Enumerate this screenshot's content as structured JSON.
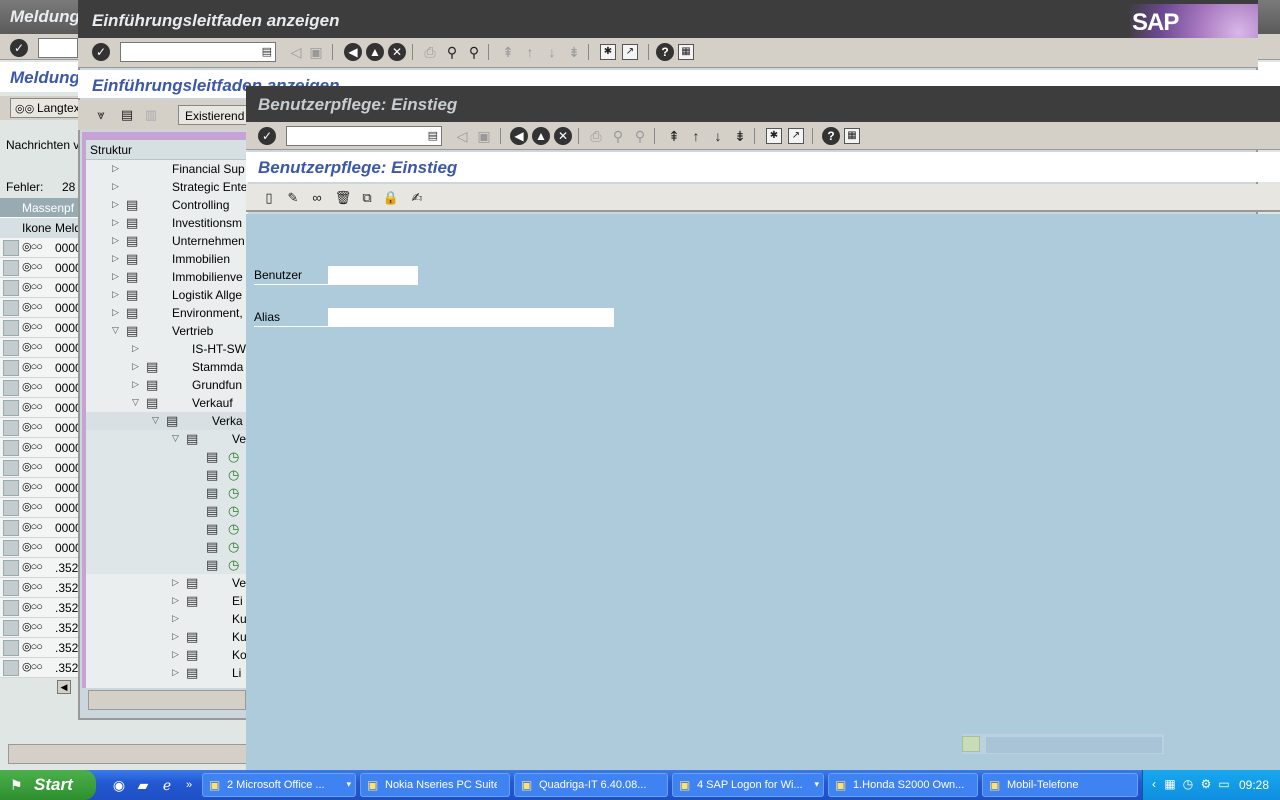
{
  "window_back": {
    "title": "Meldung",
    "app_title": "Meldung",
    "langtext_button": "Langtex",
    "nachrichten_label": "Nachrichten v",
    "fehler_label": "Fehler:",
    "fehler_count": "28",
    "table_header": "Massenpf",
    "columns": [
      "Ikone",
      "Meld"
    ],
    "rows": [
      {
        "lights": "◎○○",
        "msg": "0000"
      },
      {
        "lights": "◎○○",
        "msg": "0000"
      },
      {
        "lights": "◎○○",
        "msg": "0000"
      },
      {
        "lights": "◎○○",
        "msg": "0000"
      },
      {
        "lights": "◎○○",
        "msg": "0000"
      },
      {
        "lights": "◎○○",
        "msg": "0000"
      },
      {
        "lights": "◎○○",
        "msg": "0000"
      },
      {
        "lights": "◎○○",
        "msg": "0000"
      },
      {
        "lights": "◎○○",
        "msg": "0000"
      },
      {
        "lights": "◎○○",
        "msg": "0000"
      },
      {
        "lights": "◎○○",
        "msg": "0000"
      },
      {
        "lights": "◎○○",
        "msg": "0000"
      },
      {
        "lights": "◎○○",
        "msg": "0000"
      },
      {
        "lights": "◎○○",
        "msg": "0000"
      },
      {
        "lights": "◎○○",
        "msg": "0000"
      },
      {
        "lights": "◎○○",
        "msg": "0000"
      },
      {
        "lights": "◎○○",
        "msg": ".352"
      },
      {
        "lights": "◎○○",
        "msg": ".352"
      },
      {
        "lights": "◎○○",
        "msg": ".352"
      },
      {
        "lights": "◎○○",
        "msg": ".352"
      },
      {
        "lights": "◎○○",
        "msg": ".352"
      },
      {
        "lights": "◎○○",
        "msg": ".352"
      }
    ]
  },
  "window_middle": {
    "title": "Einführungsleitfaden anzeigen",
    "app_title": "Einführungsleitfaden anzeigen",
    "sap_logo": "SAP",
    "existierend_button": "Existierend",
    "tree_header": "Struktur",
    "tree": [
      {
        "label": "Financial Sup",
        "indent": 0,
        "expanded": false,
        "doc": false
      },
      {
        "label": "Strategic Ente",
        "indent": 0,
        "expanded": false,
        "doc": false
      },
      {
        "label": "Controlling",
        "indent": 0,
        "expanded": false,
        "doc": true
      },
      {
        "label": "Investitionsm",
        "indent": 0,
        "expanded": false,
        "doc": true
      },
      {
        "label": "Unternehmen",
        "indent": 0,
        "expanded": false,
        "doc": true
      },
      {
        "label": "Immobilien",
        "indent": 0,
        "expanded": false,
        "doc": true
      },
      {
        "label": "Immobilienve",
        "indent": 0,
        "expanded": false,
        "doc": true
      },
      {
        "label": "Logistik Allge",
        "indent": 0,
        "expanded": false,
        "doc": true
      },
      {
        "label": "Environment,",
        "indent": 0,
        "expanded": false,
        "doc": true
      },
      {
        "label": "Vertrieb",
        "indent": 0,
        "expanded": true,
        "doc": true
      },
      {
        "label": "IS-HT-SW",
        "indent": 1,
        "expanded": false,
        "doc": false
      },
      {
        "label": "Stammda",
        "indent": 1,
        "expanded": false,
        "doc": true
      },
      {
        "label": "Grundfun",
        "indent": 1,
        "expanded": false,
        "doc": true
      },
      {
        "label": "Verkauf",
        "indent": 1,
        "expanded": true,
        "doc": true
      },
      {
        "label": "Verka",
        "indent": 2,
        "expanded": true,
        "doc": true
      },
      {
        "label": "Ve",
        "indent": 3,
        "expanded": true,
        "doc": true
      },
      {
        "label": "",
        "indent": 4,
        "leaf": true
      },
      {
        "label": "",
        "indent": 4,
        "leaf": true
      },
      {
        "label": "",
        "indent": 4,
        "leaf": true
      },
      {
        "label": "",
        "indent": 4,
        "leaf": true
      },
      {
        "label": "",
        "indent": 4,
        "leaf": true
      },
      {
        "label": "",
        "indent": 4,
        "leaf": true
      },
      {
        "label": "",
        "indent": 4,
        "leaf": true
      },
      {
        "label": "Ve",
        "indent": 3,
        "expanded": false,
        "doc": true
      },
      {
        "label": "Ei",
        "indent": 3,
        "expanded": false,
        "doc": true
      },
      {
        "label": "Ku",
        "indent": 3,
        "expanded": false,
        "doc": false
      },
      {
        "label": "Ku",
        "indent": 3,
        "expanded": false,
        "doc": true
      },
      {
        "label": "Ko",
        "indent": 3,
        "expanded": false,
        "doc": true
      },
      {
        "label": "Li",
        "indent": 3,
        "expanded": false,
        "doc": true
      }
    ]
  },
  "window_front": {
    "title": "Benutzerpflege: Einstieg",
    "app_title": "Benutzerpflege: Einstieg",
    "fields": {
      "benutzer_label": "Benutzer",
      "benutzer_value": "",
      "alias_label": "Alias",
      "alias_value": ""
    }
  },
  "taskbar": {
    "start_label": "Start",
    "tasks": [
      {
        "label": "2 Microsoft Office ...",
        "dropdown": true
      },
      {
        "label": "Nokia Nseries PC Suite",
        "dropdown": false
      },
      {
        "label": "Quadriga-IT 6.40.08...",
        "dropdown": false
      },
      {
        "label": "4 SAP Logon for Wi...",
        "dropdown": true
      },
      {
        "label": "1.Honda S2000 Own...",
        "dropdown": false
      },
      {
        "label": "Mobil-Telefone",
        "dropdown": false
      }
    ],
    "clock": "09:28"
  },
  "colors": {
    "sap_title_blue": "#3c58a8",
    "titlebar_dark": "#3d3d3d",
    "front_body_blue": "#aecbdc",
    "tree_frame_purple": "#c7a2d5",
    "taskbar_blue": "#2459d3",
    "start_green": "#2f8f2f"
  }
}
